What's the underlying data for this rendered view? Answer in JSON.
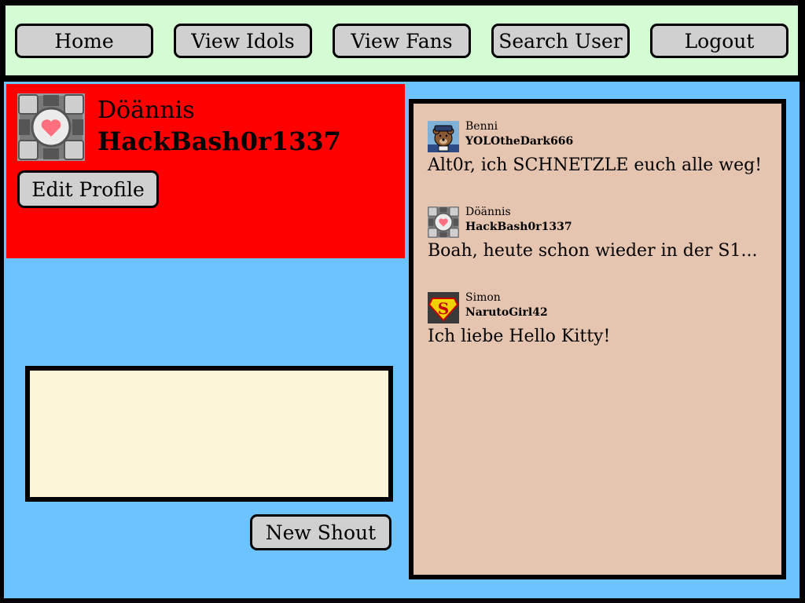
{
  "nav": {
    "home": "Home",
    "view_idols": "View Idols",
    "view_fans": "View Fans",
    "search_user": "Search User",
    "logout": "Logout"
  },
  "profile": {
    "name": "Döännis",
    "handle": "HackBash0r1337",
    "edit_label": "Edit Profile",
    "avatar_icon": "companion-cube-icon"
  },
  "composer": {
    "value": "",
    "submit_label": "New Shout"
  },
  "feed": {
    "shouts": [
      {
        "name": "Benni",
        "handle": "YOLOtheDark666",
        "text": "Alt0r, ich SCHNETZLE euch alle weg!",
        "avatar_icon": "police-bear-avatar-icon"
      },
      {
        "name": "Döännis",
        "handle": "HackBash0r1337",
        "text": "Boah, heute schon wieder in der S1...",
        "avatar_icon": "companion-cube-icon"
      },
      {
        "name": "Simon",
        "handle": "NarutoGirl42",
        "text": "Ich liebe Hello Kitty!",
        "avatar_icon": "superman-logo-icon"
      }
    ]
  },
  "colors": {
    "topbar": "#d4fdd4",
    "main_bg": "#6cc3ff",
    "profile_card": "#ff0000",
    "feed_bg": "#e6c5b0",
    "composer_bg": "#fcf5d8",
    "button_bg": "#d0d0d0"
  }
}
